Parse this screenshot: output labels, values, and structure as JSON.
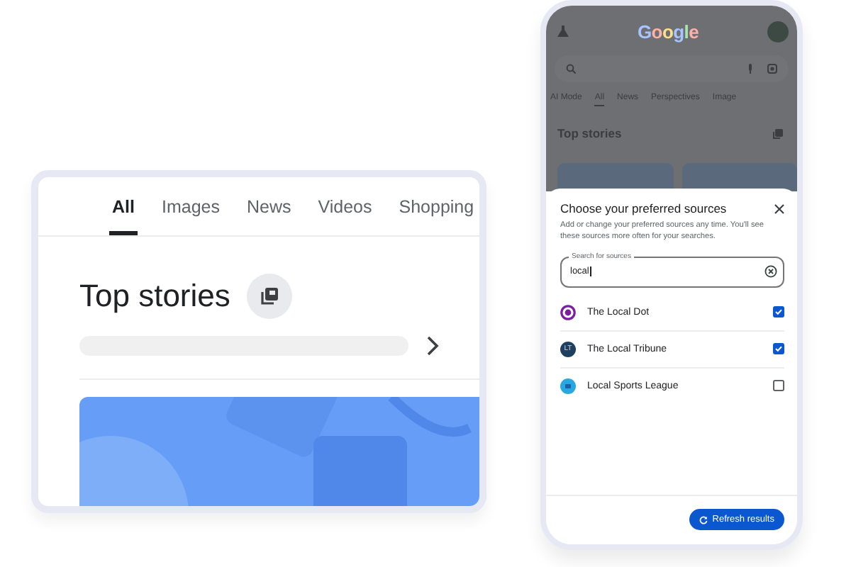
{
  "search_page": {
    "tabs": [
      {
        "label": "All",
        "selected": true
      },
      {
        "label": "Images",
        "selected": false
      },
      {
        "label": "News",
        "selected": false
      },
      {
        "label": "Videos",
        "selected": false
      },
      {
        "label": "Shopping",
        "selected": false
      }
    ],
    "section_title": "Top stories"
  },
  "phone": {
    "logo": "Google",
    "tabs": [
      {
        "label": "AI Mode",
        "selected": false
      },
      {
        "label": "All",
        "selected": true
      },
      {
        "label": "News",
        "selected": false
      },
      {
        "label": "Perspectives",
        "selected": false
      },
      {
        "label": "Image",
        "selected": false
      }
    ],
    "section_title": "Top stories",
    "sheet": {
      "title": "Choose your preferred sources",
      "description": "Add or change your preferred sources any time. You'll see these sources more often for your searches.",
      "search": {
        "label": "Search for sources",
        "value": "local"
      },
      "sources": [
        {
          "name": "The Local Dot",
          "checked": true,
          "color": "#7b1fa2",
          "kind": "ring"
        },
        {
          "name": "The Local Tribune",
          "checked": true,
          "color": "#1f3f5f",
          "kind": "initials",
          "initials": "LT"
        },
        {
          "name": "Local Sports League",
          "checked": false,
          "color": "#29a8e0",
          "kind": "badge"
        }
      ],
      "button": "Refresh results"
    }
  }
}
